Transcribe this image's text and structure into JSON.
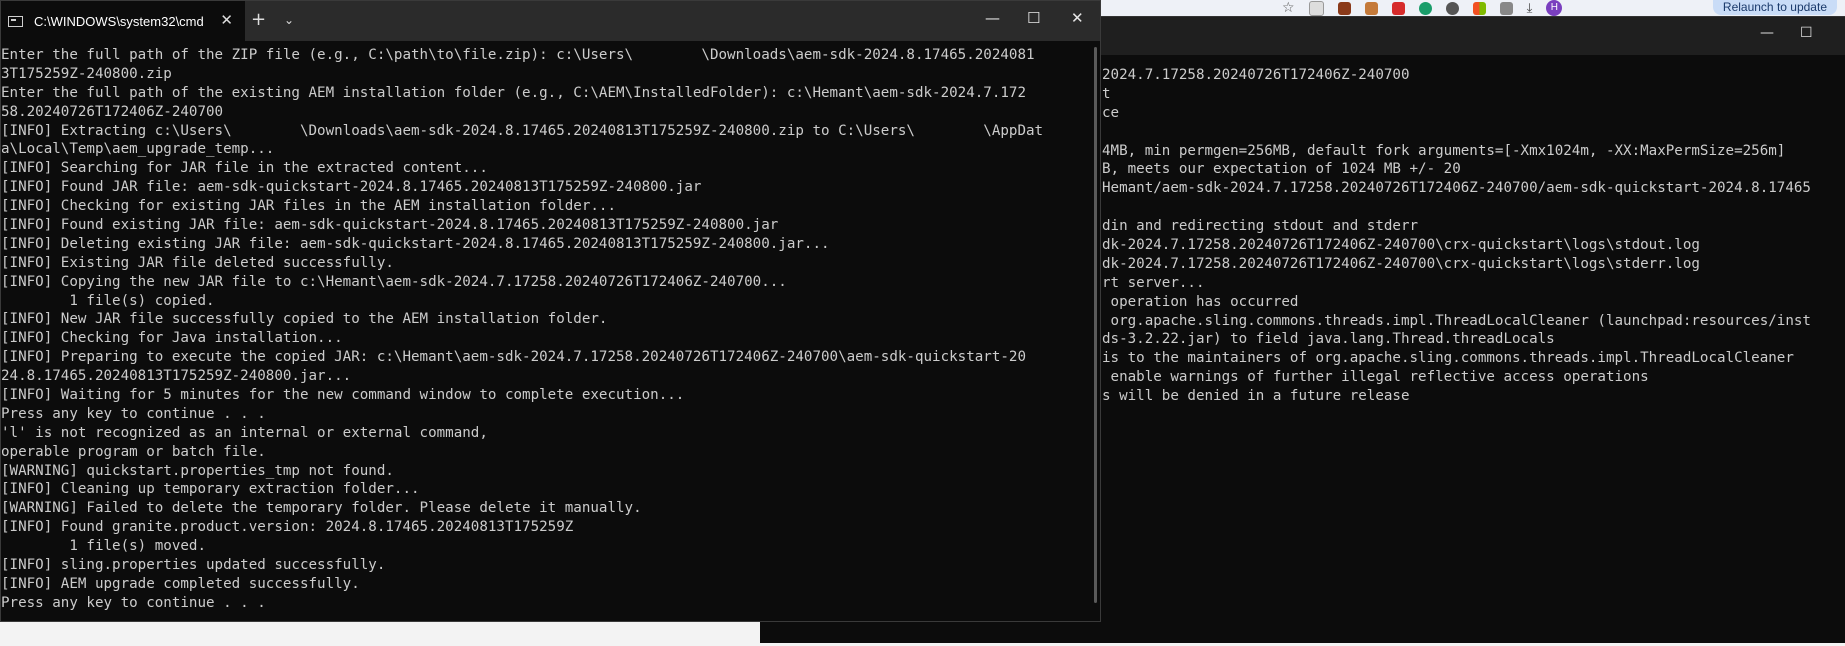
{
  "main_window": {
    "tab_title": "C:\\WINDOWS\\system32\\cmd.",
    "lines": [
      "Enter the full path of the ZIP file (e.g., C:\\path\\to\\file.zip): c:\\Users\\        \\Downloads\\aem-sdk-2024.8.17465.2024081",
      "3T175259Z-240800.zip",
      "Enter the full path of the existing AEM installation folder (e.g., C:\\AEM\\InstalledFolder): c:\\Hemant\\aem-sdk-2024.7.172",
      "58.20240726T172406Z-240700",
      "[INFO] Extracting c:\\Users\\        \\Downloads\\aem-sdk-2024.8.17465.20240813T175259Z-240800.zip to C:\\Users\\        \\AppDat",
      "a\\Local\\Temp\\aem_upgrade_temp...",
      "[INFO] Searching for JAR file in the extracted content...",
      "[INFO] Found JAR file: aem-sdk-quickstart-2024.8.17465.20240813T175259Z-240800.jar",
      "[INFO] Checking for existing JAR files in the AEM installation folder...",
      "[INFO] Found existing JAR file: aem-sdk-quickstart-2024.8.17465.20240813T175259Z-240800.jar",
      "[INFO] Deleting existing JAR file: aem-sdk-quickstart-2024.8.17465.20240813T175259Z-240800.jar...",
      "[INFO] Existing JAR file deleted successfully.",
      "[INFO] Copying the new JAR file to c:\\Hemant\\aem-sdk-2024.7.17258.20240726T172406Z-240700...",
      "        1 file(s) copied.",
      "[INFO] New JAR file successfully copied to the AEM installation folder.",
      "[INFO] Checking for Java installation...",
      "[INFO] Preparing to execute the copied JAR: c:\\Hemant\\aem-sdk-2024.7.17258.20240726T172406Z-240700\\aem-sdk-quickstart-20",
      "24.8.17465.20240813T175259Z-240800.jar...",
      "[INFO] Waiting for 5 minutes for the new command window to complete execution...",
      "Press any key to continue . . .",
      "'l' is not recognized as an internal or external command,",
      "operable program or batch file.",
      "[WARNING] quickstart.properties_tmp not found.",
      "[INFO] Cleaning up temporary extraction folder...",
      "[WARNING] Failed to delete the temporary folder. Please delete it manually.",
      "[INFO] Found granite.product.version: 2024.8.17465.20240813T175259Z",
      "        1 file(s) moved.",
      "[INFO] sling.properties updated successfully.",
      "[INFO] AEM upgrade completed successfully.",
      "Press any key to continue . . ."
    ]
  },
  "background_window": {
    "lines": [
      "2024.7.17258.20240726T172406Z-240700",
      "t",
      "ce",
      "",
      "4MB, min permgen=256MB, default fork arguments=[-Xmx1024m, -XX:MaxPermSize=256m]",
      "B, meets our expectation of 1024 MB +/- 20",
      "Hemant/aem-sdk-2024.7.17258.20240726T172406Z-240700/aem-sdk-quickstart-2024.8.17465",
      "",
      "din and redirecting stdout and stderr",
      "dk-2024.7.17258.20240726T172406Z-240700\\crx-quickstart\\logs\\stdout.log",
      "dk-2024.7.17258.20240726T172406Z-240700\\crx-quickstart\\logs\\stderr.log",
      "rt server...",
      " operation has occurred",
      " org.apache.sling.commons.threads.impl.ThreadLocalCleaner (launchpad:resources/inst",
      "ds-3.2.22.jar) to field java.lang.Thread.threadLocals",
      "is to the maintainers of org.apache.sling.commons.threads.impl.ThreadLocalCleaner",
      " enable warnings of further illegal reflective access operations",
      "s will be denied in a future release"
    ]
  },
  "browser": {
    "relaunch_label": "Relaunch to update",
    "avatar_letter": "H"
  },
  "icons": {
    "close": "✕",
    "new_tab": "+",
    "dropdown": "⌄",
    "minimize": "—",
    "maximize": "☐"
  }
}
